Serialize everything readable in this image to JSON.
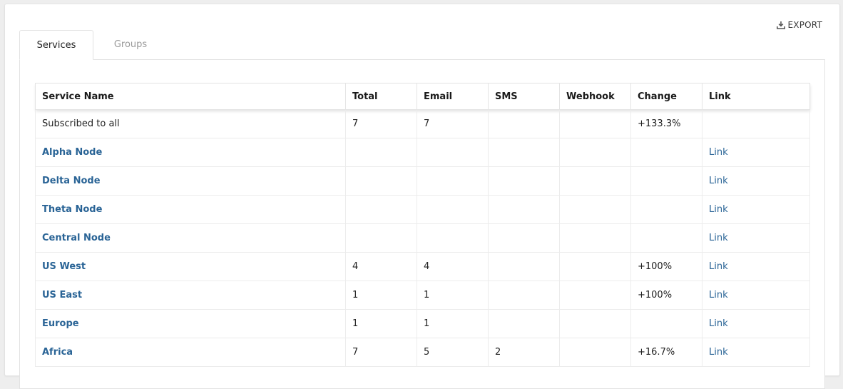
{
  "toolbar": {
    "export_label": "EXPORT",
    "export_icon": "download-icon"
  },
  "tabs": [
    {
      "label": "Services",
      "active": true
    },
    {
      "label": "Groups",
      "active": false
    }
  ],
  "colors": {
    "link": "#2a6496",
    "inactive_tab": "#9a9a9a"
  },
  "table": {
    "columns": [
      "Service Name",
      "Total",
      "Email",
      "SMS",
      "Webhook",
      "Change",
      "Link"
    ],
    "rows": [
      {
        "name": "Subscribed to all",
        "total": "7",
        "email": "7",
        "sms": "",
        "webhook": "",
        "change": "+133.3%",
        "link": ""
      },
      {
        "name": "Alpha Node",
        "total": "",
        "email": "",
        "sms": "",
        "webhook": "",
        "change": "",
        "link": "Link"
      },
      {
        "name": "Delta Node",
        "total": "",
        "email": "",
        "sms": "",
        "webhook": "",
        "change": "",
        "link": "Link"
      },
      {
        "name": "Theta Node",
        "total": "",
        "email": "",
        "sms": "",
        "webhook": "",
        "change": "",
        "link": "Link"
      },
      {
        "name": "Central Node",
        "total": "",
        "email": "",
        "sms": "",
        "webhook": "",
        "change": "",
        "link": "Link"
      },
      {
        "name": "US West",
        "total": "4",
        "email": "4",
        "sms": "",
        "webhook": "",
        "change": "+100%",
        "link": "Link"
      },
      {
        "name": "US East",
        "total": "1",
        "email": "1",
        "sms": "",
        "webhook": "",
        "change": "+100%",
        "link": "Link"
      },
      {
        "name": "Europe",
        "total": "1",
        "email": "1",
        "sms": "",
        "webhook": "",
        "change": "",
        "link": "Link"
      },
      {
        "name": "Africa",
        "total": "7",
        "email": "5",
        "sms": "2",
        "webhook": "",
        "change": "+16.7%",
        "link": "Link"
      }
    ]
  }
}
